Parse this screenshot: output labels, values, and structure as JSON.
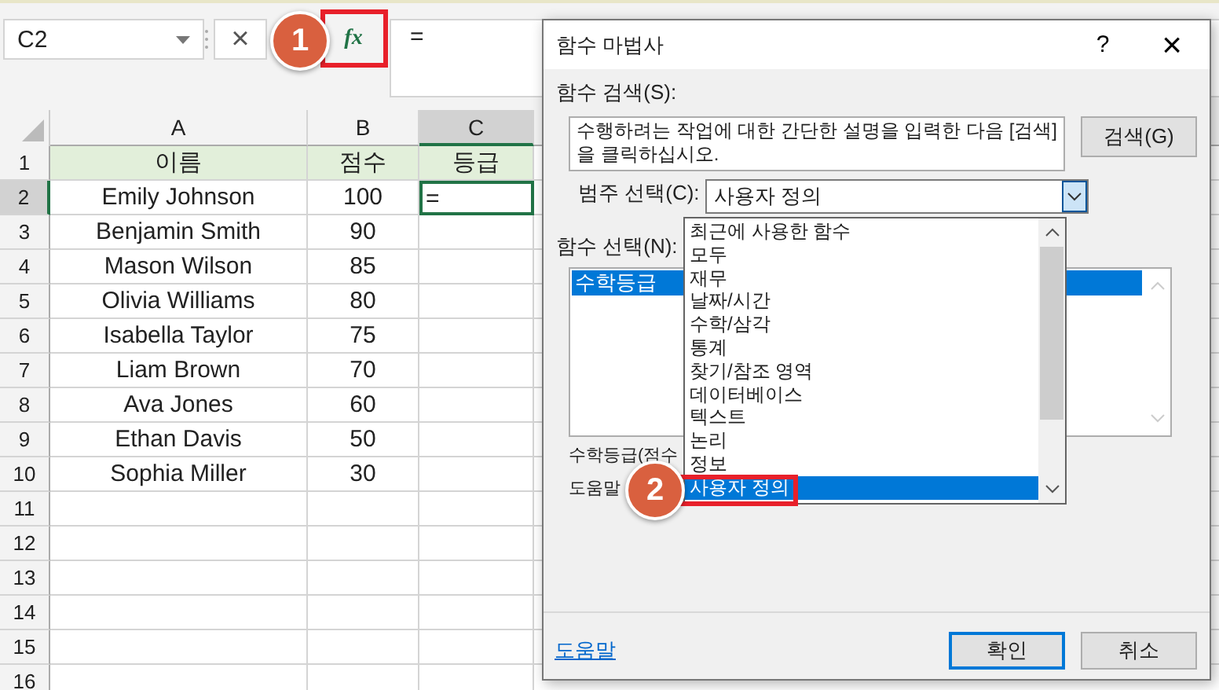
{
  "name_box": {
    "value": "C2"
  },
  "formula_bar": {
    "cancel": "×",
    "fx": "fx",
    "value": "="
  },
  "sheet": {
    "columns": [
      {
        "label": "A",
        "selected": false
      },
      {
        "label": "B",
        "selected": false
      },
      {
        "label": "C",
        "selected": true
      }
    ],
    "rows": [
      {
        "number": "1",
        "selected": false,
        "kind": "header",
        "cells": [
          {
            "text": "이름",
            "active": false
          },
          {
            "text": "점수",
            "active": false
          },
          {
            "text": "등급",
            "active": false
          }
        ]
      },
      {
        "number": "2",
        "selected": true,
        "kind": "data",
        "cells": [
          {
            "text": "Emily Johnson",
            "active": false
          },
          {
            "text": "100",
            "active": false
          },
          {
            "text": "=",
            "active": true
          }
        ]
      },
      {
        "number": "3",
        "selected": false,
        "kind": "data",
        "cells": [
          {
            "text": "Benjamin Smith",
            "active": false
          },
          {
            "text": "90",
            "active": false
          },
          {
            "active": false
          }
        ]
      },
      {
        "number": "4",
        "selected": false,
        "kind": "data",
        "cells": [
          {
            "text": "Mason Wilson",
            "active": false
          },
          {
            "text": "85",
            "active": false
          },
          {
            "active": false
          }
        ]
      },
      {
        "number": "5",
        "selected": false,
        "kind": "data",
        "cells": [
          {
            "text": "Olivia Williams",
            "active": false
          },
          {
            "text": "80",
            "active": false
          },
          {
            "active": false
          }
        ]
      },
      {
        "number": "6",
        "selected": false,
        "kind": "data",
        "cells": [
          {
            "text": "Isabella Taylor",
            "active": false
          },
          {
            "text": "75",
            "active": false
          },
          {
            "active": false
          }
        ]
      },
      {
        "number": "7",
        "selected": false,
        "kind": "data",
        "cells": [
          {
            "text": "Liam Brown",
            "active": false
          },
          {
            "text": "70",
            "active": false
          },
          {
            "active": false
          }
        ]
      },
      {
        "number": "8",
        "selected": false,
        "kind": "data",
        "cells": [
          {
            "text": "Ava Jones",
            "active": false
          },
          {
            "text": "60",
            "active": false
          },
          {
            "active": false
          }
        ]
      },
      {
        "number": "9",
        "selected": false,
        "kind": "data",
        "cells": [
          {
            "text": "Ethan Davis",
            "active": false
          },
          {
            "text": "50",
            "active": false
          },
          {
            "active": false
          }
        ]
      },
      {
        "number": "10",
        "selected": false,
        "kind": "data",
        "cells": [
          {
            "text": "Sophia Miller",
            "active": false
          },
          {
            "text": "30",
            "active": false
          },
          {
            "active": false
          }
        ]
      },
      {
        "number": "11",
        "selected": false,
        "kind": "data",
        "cells": [
          {
            "active": false
          },
          {
            "active": false
          },
          {
            "active": false
          }
        ]
      },
      {
        "number": "12",
        "selected": false,
        "kind": "data",
        "cells": [
          {
            "active": false
          },
          {
            "active": false
          },
          {
            "active": false
          }
        ]
      },
      {
        "number": "13",
        "selected": false,
        "kind": "data",
        "cells": [
          {
            "active": false
          },
          {
            "active": false
          },
          {
            "active": false
          }
        ]
      },
      {
        "number": "14",
        "selected": false,
        "kind": "data",
        "cells": [
          {
            "active": false
          },
          {
            "active": false
          },
          {
            "active": false
          }
        ]
      },
      {
        "number": "15",
        "selected": false,
        "kind": "data",
        "cells": [
          {
            "active": false
          },
          {
            "active": false
          },
          {
            "active": false
          }
        ]
      },
      {
        "number": "16",
        "selected": false,
        "kind": "data",
        "cells": [
          {
            "active": false
          },
          {
            "active": false
          },
          {
            "active": false
          }
        ]
      }
    ]
  },
  "callouts": [
    {
      "label": "1"
    },
    {
      "label": "2"
    }
  ],
  "dialog": {
    "title": "함수 마법사",
    "help": "?",
    "close": "×",
    "search_label": "함수 검색(S):",
    "search_text": "수행하려는 작업에 대한 간단한 설명을 입력한 다음 [검색]을 클릭하십시오.",
    "search_button": "검색(G)",
    "category_label": "범주 선택(C):",
    "category_value": "사용자 정의",
    "category_options": [
      {
        "label": "최근에 사용한 함수",
        "selected": false
      },
      {
        "label": "모두",
        "selected": false
      },
      {
        "label": "재무",
        "selected": false
      },
      {
        "label": "날짜/시간",
        "selected": false
      },
      {
        "label": "수학/삼각",
        "selected": false
      },
      {
        "label": "통계",
        "selected": false
      },
      {
        "label": "찾기/참조 영역",
        "selected": false
      },
      {
        "label": "데이터베이스",
        "selected": false
      },
      {
        "label": "텍스트",
        "selected": false
      },
      {
        "label": "논리",
        "selected": false
      },
      {
        "label": "정보",
        "selected": false
      },
      {
        "label": "사용자 정의",
        "selected": true
      }
    ],
    "function_label": "함수 선택(N):",
    "functions": [
      {
        "label": "수학등급",
        "selected": true
      }
    ],
    "description": "수학등급(점수",
    "help_label": "도움말",
    "help_link": "도움말",
    "buttons": [
      {
        "label": "확인",
        "selected": true
      },
      {
        "label": "취소",
        "selected": false
      }
    ]
  }
}
